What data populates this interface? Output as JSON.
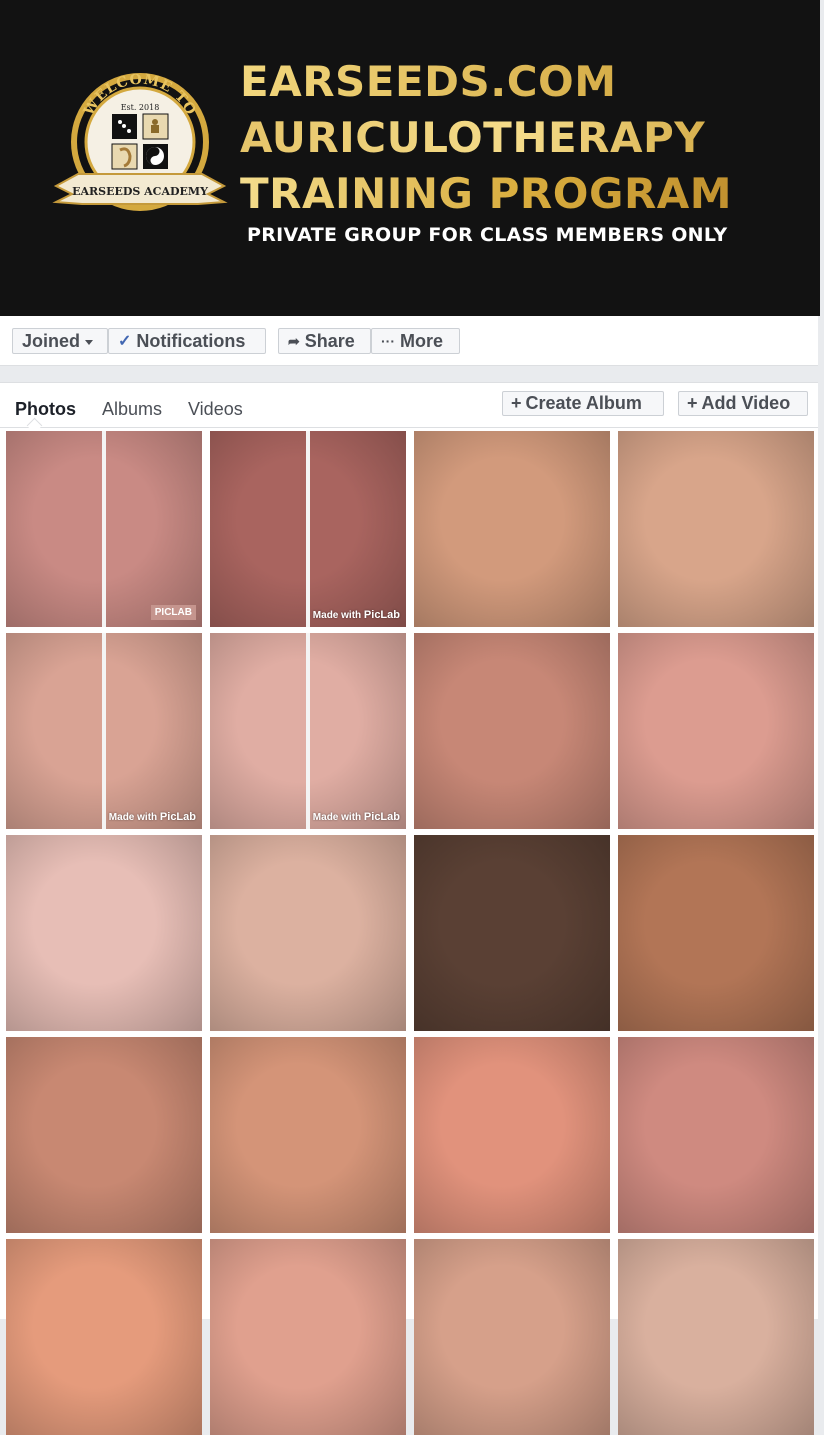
{
  "banner": {
    "badge_top": "WELCOME TO",
    "badge_est": "Est. 2018",
    "badge_ribbon": "EARSEEDS ACADEMY",
    "title_line1": "EARSEEDS.COM",
    "title_line2": "AURICULOTHERAPY",
    "title_line3": "TRAINING PROGRAM",
    "subtitle": "PRIVATE GROUP FOR CLASS MEMBERS ONLY"
  },
  "actions": {
    "joined": "Joined",
    "notifications": "Notifications",
    "share": "Share",
    "more": "More"
  },
  "panel": {
    "tabs": [
      "Photos",
      "Albums",
      "Videos"
    ],
    "create_album": "Create Album",
    "add_video": "Add Video"
  },
  "watermarks": {
    "made_with": "Made with",
    "piclab": "PicLab",
    "piclab_caps": "PICLAB"
  },
  "photos": [
    {
      "tone": "#c98a84",
      "split": true,
      "wm": "caps"
    },
    {
      "tone": "#a9645f",
      "split": true,
      "wm": "made"
    },
    {
      "tone": "#d29a7c",
      "split": false,
      "wm": ""
    },
    {
      "tone": "#d8a58a",
      "split": false,
      "wm": ""
    },
    {
      "tone": "#d9a394",
      "split": true,
      "wm": "made"
    },
    {
      "tone": "#e0ada3",
      "split": true,
      "wm": "made"
    },
    {
      "tone": "#c78776",
      "split": false,
      "wm": ""
    },
    {
      "tone": "#dc9c90",
      "split": false,
      "wm": ""
    },
    {
      "tone": "#e7beb6",
      "split": false,
      "wm": ""
    },
    {
      "tone": "#dcb1a0",
      "split": false,
      "wm": ""
    },
    {
      "tone": "#5a4034",
      "split": false,
      "wm": ""
    },
    {
      "tone": "#b27556",
      "split": false,
      "wm": ""
    },
    {
      "tone": "#c88872",
      "split": false,
      "wm": ""
    },
    {
      "tone": "#d49478",
      "split": false,
      "wm": ""
    },
    {
      "tone": "#e1927c",
      "split": false,
      "wm": ""
    },
    {
      "tone": "#cf8a80",
      "split": false,
      "wm": ""
    },
    {
      "tone": "#e59b7c",
      "split": false,
      "wm": ""
    },
    {
      "tone": "#e0a08e",
      "split": false,
      "wm": ""
    },
    {
      "tone": "#d6a08a",
      "split": false,
      "wm": ""
    },
    {
      "tone": "#d9b09e",
      "split": false,
      "wm": ""
    }
  ],
  "colors": {
    "banner_bg": "#121212",
    "gold": "#e0b54c",
    "fb_blue": "#4267b2"
  }
}
